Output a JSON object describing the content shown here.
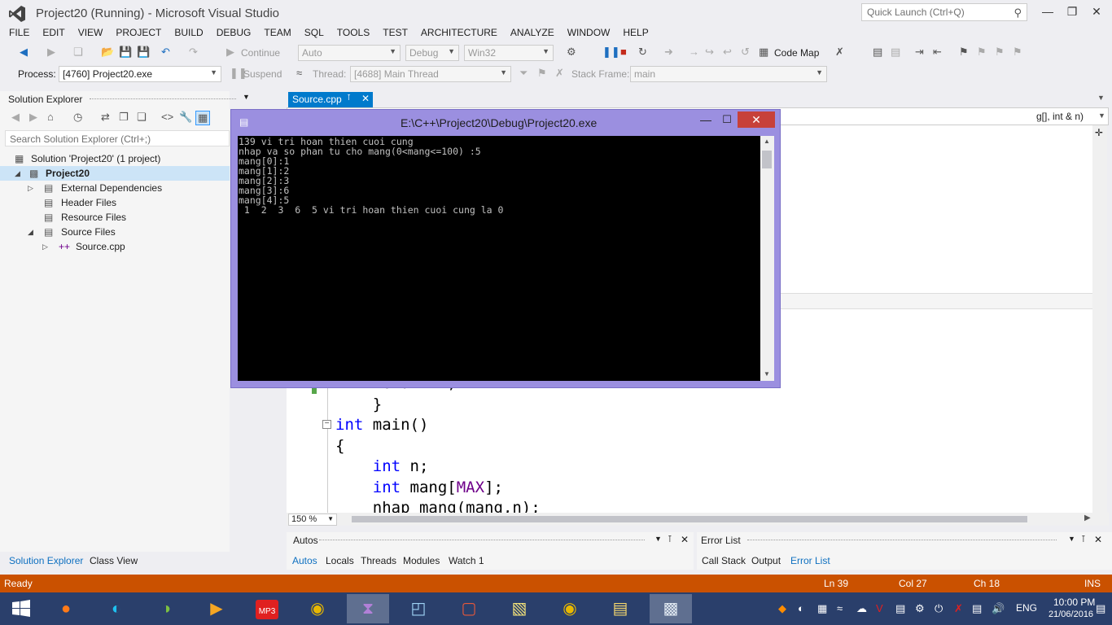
{
  "window": {
    "title": "Project20 (Running) - Microsoft Visual Studio",
    "quick_launch_placeholder": "Quick Launch (Ctrl+Q)"
  },
  "menu": [
    "FILE",
    "EDIT",
    "VIEW",
    "PROJECT",
    "BUILD",
    "DEBUG",
    "TEAM",
    "SQL",
    "TOOLS",
    "TEST",
    "ARCHITECTURE",
    "ANALYZE",
    "WINDOW",
    "HELP"
  ],
  "toolbar1": {
    "continue_label": "Continue",
    "config_auto": "Auto",
    "config_debug": "Debug",
    "platform": "Win32",
    "code_map_label": "Code Map"
  },
  "toolbar2": {
    "process_label": "Process:",
    "process_value": "[4760] Project20.exe",
    "suspend_label": "Suspend",
    "thread_label": "Thread:",
    "thread_value": "[4688] Main Thread",
    "stack_frame_label": "Stack Frame:",
    "stack_frame_value": "main"
  },
  "solution_explorer": {
    "title": "Solution Explorer",
    "search_placeholder": "Search Solution Explorer (Ctrl+;)",
    "items": [
      {
        "label": "Solution 'Project20' (1 project)"
      },
      {
        "label": "Project20"
      },
      {
        "label": "External Dependencies"
      },
      {
        "label": "Header Files"
      },
      {
        "label": "Resource Files"
      },
      {
        "label": "Source Files"
      },
      {
        "label": "Source.cpp"
      }
    ],
    "tabs": [
      "Solution Explorer",
      "Class View"
    ]
  },
  "editor": {
    "tab_label": "Source.cpp",
    "nav_func": "g[], int & n)",
    "zoom": "150 %",
    "code": {
      "line0": "return 1;",
      "line1": "}",
      "line2_kw": "int",
      "line2_rest": " main()",
      "line3": "{",
      "line4_kw": "int",
      "line4_rest": " n;",
      "line5_kw": "int",
      "line5_a": " mang[",
      "line5_mac": "MAX",
      "line5_b": "];",
      "line6": "nhap mang(mang,n);"
    }
  },
  "console": {
    "title": "E:\\C++\\Project20\\Debug\\Project20.exe",
    "lines": [
      "139 vi tri hoan thien cuoi cung",
      "nhap va so phan tu cho mang(0<mang<=100) :5",
      "mang[0]:1",
      "mang[1]:2",
      "mang[2]:3",
      "mang[3]:6",
      "mang[4]:5",
      " 1  2  3  6  5 vi tri hoan thien cuoi cung la 0"
    ]
  },
  "autos": {
    "title": "Autos",
    "tabs": [
      "Autos",
      "Locals",
      "Threads",
      "Modules",
      "Watch 1"
    ]
  },
  "error_list": {
    "title": "Error List",
    "tabs": [
      "Call Stack",
      "Output",
      "Error List"
    ]
  },
  "status": {
    "ready": "Ready",
    "ln": "Ln 39",
    "col": "Col 27",
    "ch": "Ch 18",
    "ins": "INS"
  },
  "taskbar": {
    "lang": "ENG",
    "time": "10:00 PM",
    "date": "21/06/2016",
    "mp3_label": "MP3"
  },
  "colors": {
    "accent": "#007acc",
    "status_bar": "#ca5100",
    "console_frame": "#9b8fe0",
    "close_red": "#c7413a"
  }
}
